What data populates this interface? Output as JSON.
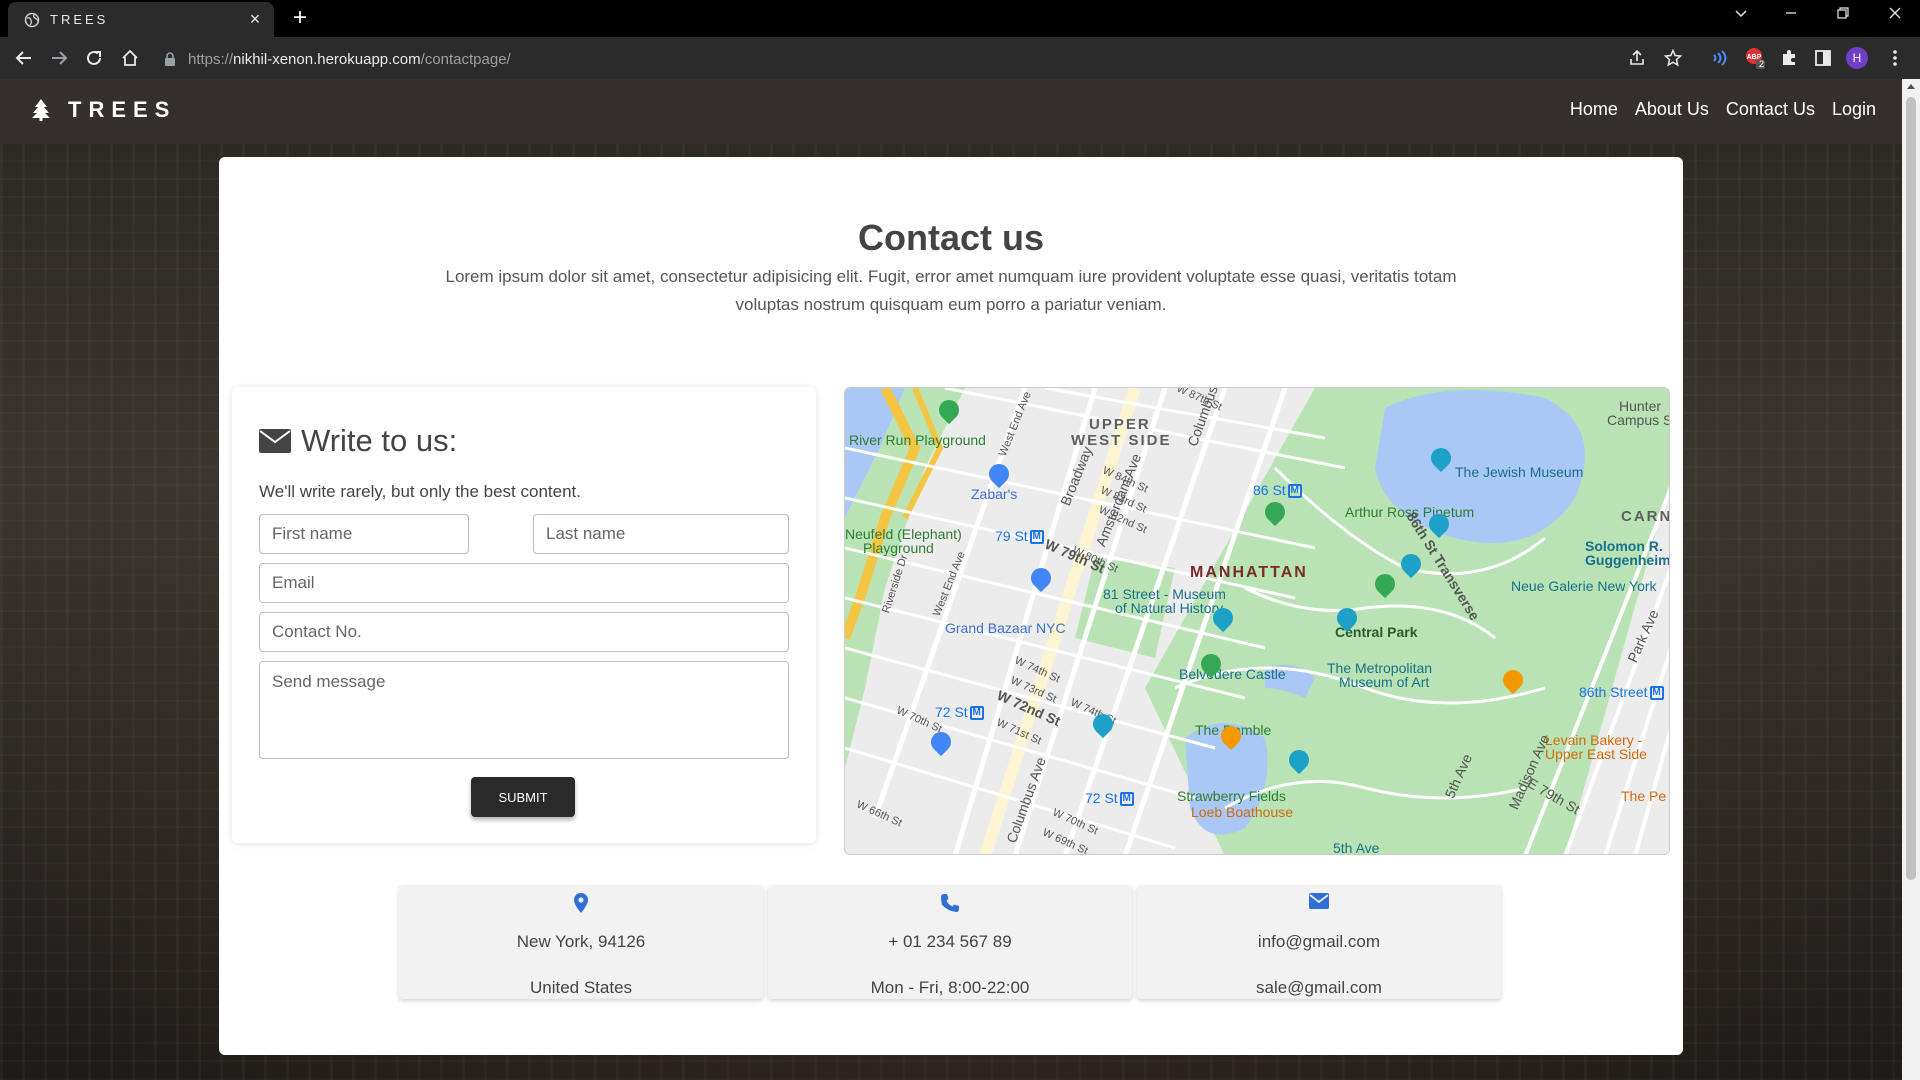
{
  "browser": {
    "tab_title": "TREES",
    "new_tab": "+",
    "close_tab": "×",
    "url_scheme": "https://",
    "url_host": "nikhil-xenon.herokuapp.com",
    "url_path": "/contactpage/",
    "profile_initial": "H",
    "extension_badge": "2"
  },
  "site": {
    "brand": "TREES",
    "nav": [
      "Home",
      "About Us",
      "Contact Us",
      "Login"
    ]
  },
  "contact": {
    "title": "Contact us",
    "intro": "Lorem ipsum dolor sit amet, consectetur adipisicing elit. Fugit, error amet numquam iure provident voluptate esse quasi, veritatis totam voluptas nostrum quisquam eum porro a pariatur veniam."
  },
  "form": {
    "heading": "Write to us:",
    "subheading": "We'll write rarely, but only the best content.",
    "first_name_placeholder": "First name",
    "last_name_placeholder": "Last name",
    "email_placeholder": "Email",
    "phone_placeholder": "Contact No.",
    "message_placeholder": "Send message",
    "submit_label": "SUBMIT"
  },
  "map": {
    "labels": {
      "upper_west_1": "UPPER",
      "upper_west_2": "WEST SIDE",
      "manhattan": "MANHATTAN",
      "river_run": "River Run Playground",
      "neufeld_1": "Neufeld (Elephant)",
      "neufeld_2": "Playground",
      "zabars": "Zabar's",
      "grand_bazaar": "Grand Bazaar NYC",
      "museum_1": "81 Street - Museum",
      "museum_2": "of Natural History",
      "jewish_museum": "The Jewish Museum",
      "arthur_ross": "Arthur Ross Pinetum",
      "central_park": "Central Park",
      "belvedere": "Belvedere Castle",
      "met_1": "The Metropolitan",
      "met_2": "Museum of Art",
      "ramble": "The Ramble",
      "strawberry": "Strawberry Fields",
      "loeb": "Loeb Boathouse",
      "guggenheim_1": "Solomon R.",
      "guggenheim_2": "Guggenheim",
      "neue_galerie": "Neue Galerie New York",
      "carnegie": "CARNE",
      "hunter_1": "Hunter",
      "hunter_2": "Campus S",
      "levain_1": "Levain Bakery -",
      "levain_2": "Upper East Side",
      "the_pe": "The Pe",
      "st_86": "86 St",
      "st_79": "79 St",
      "st_72": "72 St",
      "st_72b": "72 St",
      "street_86": "86th Street",
      "fifth_ave": "5th Ave",
      "broadway": "Broadway",
      "amsterdam": "Amsterdam Ave",
      "columbus": "Columbus Ave",
      "columbus2": "Columbus",
      "w79": "W 79th St",
      "w72": "W 72nd St",
      "w84": "W 84th St",
      "w83": "W 83rd St",
      "w82": "W 82nd St",
      "w80": "W 80th St",
      "w74": "W 74th St",
      "w73": "W 73rd St",
      "w71": "W 71st St",
      "w70": "W 70th St",
      "w70b": "W 70th St",
      "w69": "W 69th St",
      "w66": "W 66th St",
      "w87": "W 87th St",
      "w74b": "W 74th St",
      "west_end": "West End Ave",
      "west_end2": "West End Ave",
      "riverside": "Riverside Dr",
      "transverse": "86th St Transverse",
      "park_ave": "Park Ave",
      "madison": "Madison Ave",
      "fifth": "5th Ave",
      "e79": "E 79th St"
    }
  },
  "info": [
    {
      "line1": "New York, 94126",
      "line2": "United States"
    },
    {
      "line1": "+ 01 234 567 89",
      "line2": "Mon - Fri, 8:00-22:00"
    },
    {
      "line1": "info@gmail.com",
      "line2": "sale@gmail.com"
    }
  ],
  "colors": {
    "navbar": "#35302e",
    "submit_button": "#2a2a2a",
    "icon_blue": "#2f6fd6",
    "park_green": "#b9e3b4",
    "water_blue": "#a9c8f5"
  }
}
